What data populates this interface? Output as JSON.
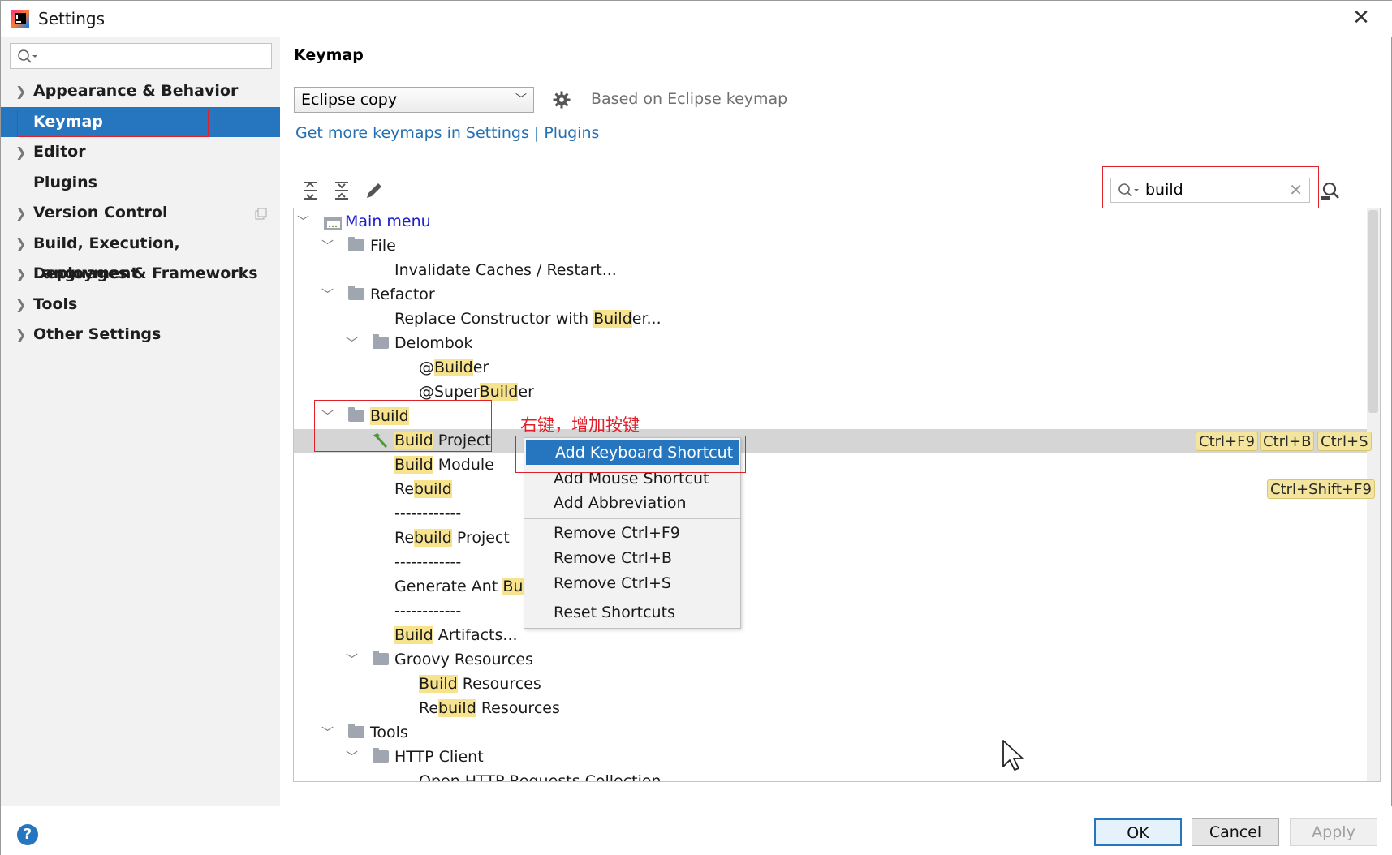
{
  "window": {
    "title": "Settings"
  },
  "sidebar": {
    "search_placeholder": "",
    "items": [
      {
        "label": "Appearance & Behavior",
        "expandable": true
      },
      {
        "label": "Keymap",
        "expandable": false
      },
      {
        "label": "Editor",
        "expandable": true
      },
      {
        "label": "Plugins",
        "expandable": false
      },
      {
        "label": "Version Control",
        "expandable": true
      },
      {
        "label": "Build, Execution, Deployment",
        "expandable": true
      },
      {
        "label": "Languages & Frameworks",
        "expandable": true
      },
      {
        "label": "Tools",
        "expandable": true
      },
      {
        "label": "Other Settings",
        "expandable": true
      }
    ],
    "selected": "Keymap"
  },
  "panel": {
    "title": "Keymap",
    "keymap_select": "Eclipse copy",
    "based_on": "Based on Eclipse keymap",
    "link_text": "Get more keymaps in Settings | Plugins",
    "filter_value": "build"
  },
  "tree": {
    "main_menu": "Main menu",
    "file": "File",
    "invalidate": "Invalidate Caches / Restart...",
    "refactor": "Refactor",
    "replace_pre": "Replace Constructor with ",
    "replace_hl": "Build",
    "replace_post": "er...",
    "delombok": "Delombok",
    "builder_pre": "@",
    "builder_hl": "Build",
    "builder_post": "er",
    "super_pre": "@Super",
    "super_hl": "Build",
    "super_post": "er",
    "build": "Build",
    "build_project_hl": "Build",
    "build_project_post": " Project",
    "build_module_hl": "Build",
    "build_module_post": " Module",
    "rebuild_pre": "Re",
    "rebuild_hl": "build",
    "separator": "------------",
    "rebuild_project_pre": "Re",
    "rebuild_project_hl": "build",
    "rebuild_project_post": " Project",
    "ant_pre": "Generate Ant ",
    "ant_hl": "Build",
    "artifacts_hl": "Build",
    "artifacts_post": " Artifacts...",
    "groovy": "Groovy Resources",
    "groovy_build_hl": "Build",
    "groovy_build_post": " Resources",
    "groovy_rebuild_pre": "Re",
    "groovy_rebuild_hl": "build",
    "groovy_rebuild_post": " Resources",
    "tools": "Tools",
    "http": "HTTP Client",
    "open_http": "Open HTTP Requests Collection"
  },
  "shortcuts": {
    "build_project": [
      "Ctrl+F9",
      "Ctrl+B",
      "Ctrl+S"
    ],
    "rebuild": "Ctrl+Shift+F9"
  },
  "context_menu": {
    "items": [
      "Add Keyboard Shortcut",
      "Add Mouse Shortcut",
      "Add Abbreviation",
      "Remove Ctrl+F9",
      "Remove Ctrl+B",
      "Remove Ctrl+S",
      "Reset Shortcuts"
    ]
  },
  "annotation": "右键，增加按键",
  "buttons": {
    "ok": "OK",
    "cancel": "Cancel",
    "apply": "Apply",
    "help": "?"
  },
  "colors": {
    "accent": "#2675bf",
    "highlight": "#f7e38e",
    "annotation": "#e0202a",
    "link": "#2470b3"
  },
  "icons": [
    "search-icon",
    "gear-icon",
    "expand-all-icon",
    "collapse-all-icon",
    "edit-icon",
    "find-shortcut-icon",
    "folder-icon",
    "hammer-icon",
    "close-icon",
    "help-icon"
  ]
}
